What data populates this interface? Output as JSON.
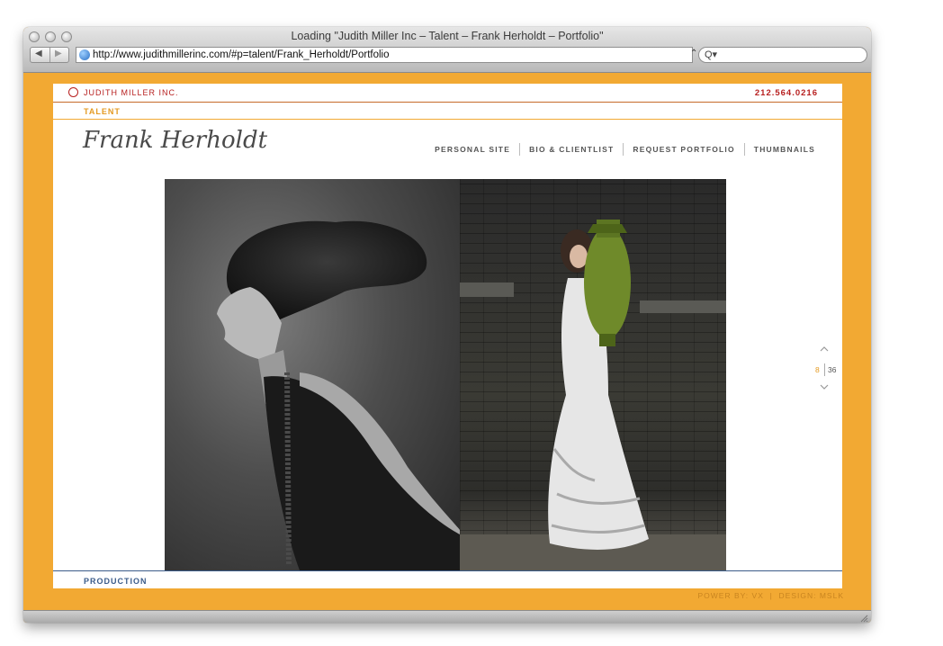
{
  "browser": {
    "window_title": "Loading \"Judith Miller Inc – Talent – Frank Herholdt – Portfolio\"",
    "url": "http://www.judithmillerinc.com/#p=talent/Frank_Herholdt/Portfolio",
    "back_glyph": "◀",
    "forward_glyph": "▶",
    "search_glyph": "Q▾",
    "url_menu_glyph": "⌃"
  },
  "site": {
    "brand": "JUDITH MILLER INC.",
    "phone": "212.564.0216",
    "section": "TALENT",
    "artist_name": "Frank Herholdt",
    "nav": [
      "PERSONAL SITE",
      "BIO & CLIENTLIST",
      "REQUEST PORTFOLIO",
      "THUMBNAILS"
    ],
    "pager": {
      "current": "8",
      "total": "36"
    },
    "footer_label": "PRODUCTION",
    "credits": "POWER BY: VX  |  DESIGN: MSLK"
  },
  "colors": {
    "frame": "#f2a933",
    "brand_red": "#b71f1f",
    "accent_orange": "#e49a22",
    "footer_blue": "#3b5c8a"
  },
  "icons": {
    "up": "chevron-up-icon",
    "down": "chevron-down-icon",
    "globe": "globe-icon",
    "search": "search-icon"
  }
}
